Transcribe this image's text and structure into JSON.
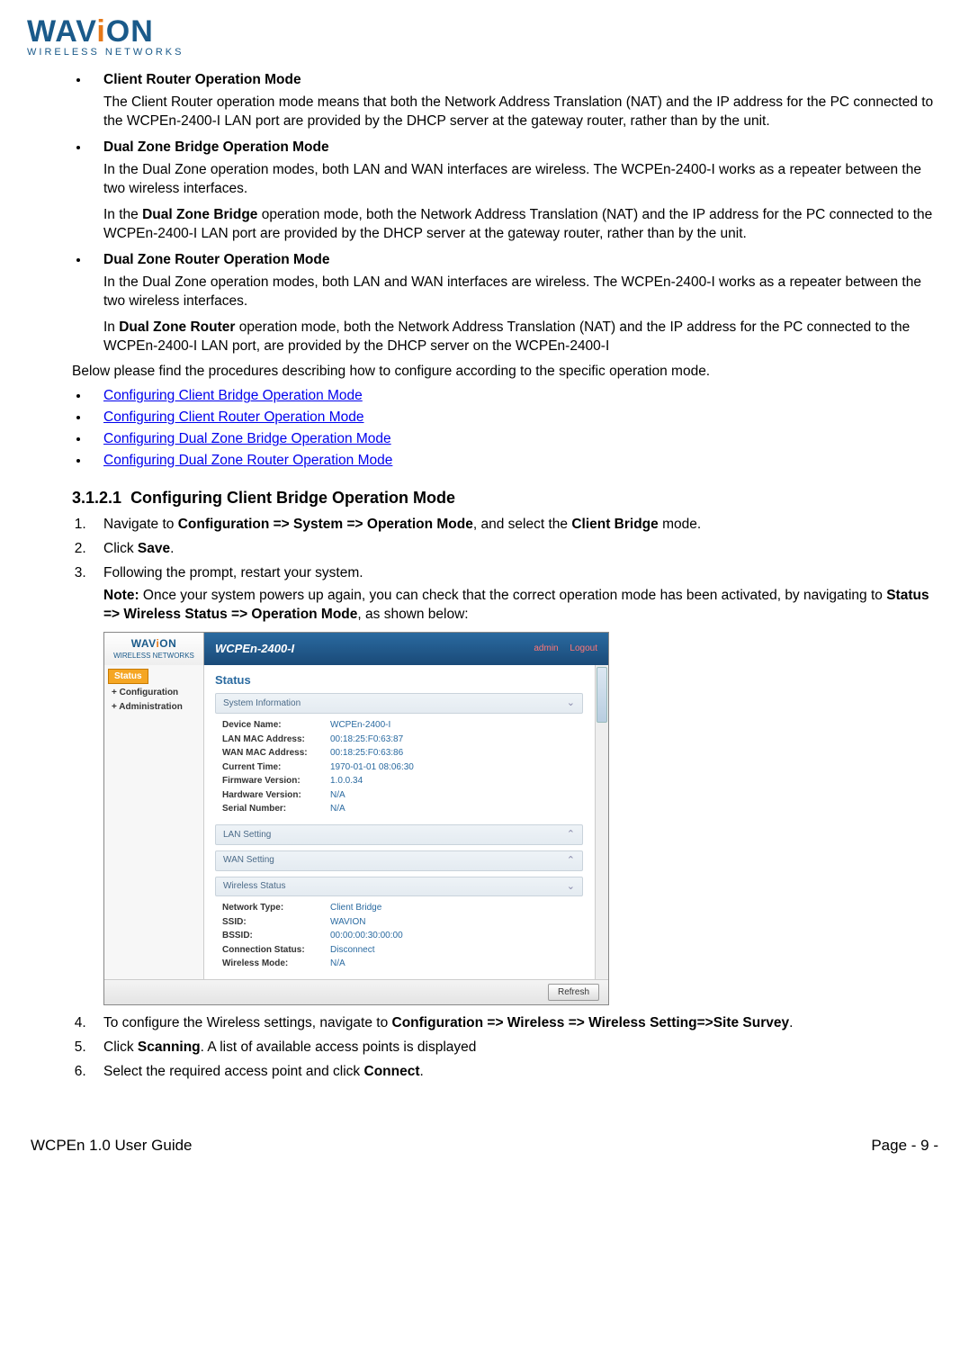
{
  "logo": {
    "main_pre": "WAV",
    "main_mid": "i",
    "main_post": "ON",
    "sub": "WIRELESS NETWORKS"
  },
  "sections": {
    "crom_title": "Client Router Operation Mode",
    "crom_body": "The Client Router operation mode means that both the Network Address Translation (NAT) and the IP address for the PC connected to the WCPEn-2400-I LAN port are provided by the DHCP server at the gateway router, rather than by the unit.",
    "dzbm_title": "Dual Zone Bridge Operation Mode",
    "dzbm_p1": "In the Dual Zone operation modes, both LAN and WAN interfaces are wireless. The WCPEn-2400-I works as a repeater between the two wireless interfaces.",
    "dzbm_p2_pre": "In the ",
    "dzbm_p2_bold": "Dual Zone Bridge",
    "dzbm_p2_post": " operation mode, both the Network Address Translation (NAT) and the IP address for the PC connected to the WCPEn-2400-I LAN port are provided by the DHCP server at the gateway router, rather than by the unit.",
    "dzrm_title": "Dual Zone Router Operation Mode",
    "dzrm_p1": "In the Dual Zone operation modes, both LAN and WAN interfaces are wireless. The WCPEn-2400-I works as a repeater between the two wireless interfaces.",
    "dzrm_p2_pre": "In ",
    "dzrm_p2_bold": "Dual Zone Router",
    "dzrm_p2_post": " operation mode, both the Network Address Translation (NAT) and the IP address for the PC connected to the WCPEn-2400-I LAN port, are provided by the DHCP server on the WCPEn-2400-I",
    "below": "Below please find the procedures describing how to configure according to the specific operation mode."
  },
  "links": {
    "l1": "Configuring Client Bridge Operation Mode",
    "l2": "Configuring Client Router Operation Mode",
    "l3": "Configuring Dual Zone Bridge Operation Mode",
    "l4": "Configuring Dual Zone Router Operation Mode"
  },
  "heading": {
    "num": "3.1.2.1",
    "text": "Configuring Client Bridge Operation Mode"
  },
  "steps": {
    "s1_pre": "Navigate to ",
    "s1_bold": "Configuration => System => Operation Mode",
    "s1_mid": ", and select the ",
    "s1_bold2": "Client Bridge",
    "s1_post": " mode.",
    "s2_pre": "Click ",
    "s2_bold": "Save",
    "s2_post": ".",
    "s3": "Following the prompt, restart your system.",
    "note_label": "Note:",
    "note_body_pre": " Once your system powers up again, you can check that the correct operation mode has been activated, by navigating to ",
    "note_body_bold": "Status => Wireless Status => Operation Mode",
    "note_body_post": ", as shown below:",
    "s4_pre": "To configure the Wireless settings, navigate to ",
    "s4_bold": "Configuration => Wireless => Wireless Setting=>Site Survey",
    "s4_post": ".",
    "s5_pre": "Click ",
    "s5_bold": "Scanning",
    "s5_post": ". A list of available access points is displayed",
    "s6_pre": "Select the required access point and click ",
    "s6_bold": "Connect",
    "s6_post": "."
  },
  "ui": {
    "title": "WCPEn-2400-I",
    "admin": "admin",
    "logout": "Logout",
    "side_status": "Status",
    "side_config": "+ Configuration",
    "side_admin": "+ Administration",
    "h_status": "Status",
    "panel_sysinfo": "System Information",
    "panel_lan": "LAN Setting",
    "panel_wan": "WAN Setting",
    "panel_wireless": "Wireless Status",
    "kv1_k": "Device Name:",
    "kv1_v": "WCPEn-2400-I",
    "kv2_k": "LAN MAC Address:",
    "kv2_v": "00:18:25:F0:63:87",
    "kv3_k": "WAN MAC Address:",
    "kv3_v": "00:18:25:F0:63:86",
    "kv4_k": "Current Time:",
    "kv4_v": "1970-01-01 08:06:30",
    "kv5_k": "Firmware Version:",
    "kv5_v": "1.0.0.34",
    "kv6_k": "Hardware Version:",
    "kv6_v": "N/A",
    "kv7_k": "Serial Number:",
    "kv7_v": "N/A",
    "wv1_k": "Network Type:",
    "wv1_v": "Client Bridge",
    "wv2_k": "SSID:",
    "wv2_v": "WAVION",
    "wv3_k": "BSSID:",
    "wv3_v": "00:00:00:30:00:00",
    "wv4_k": "Connection Status:",
    "wv4_v": "Disconnect",
    "wv5_k": "Wireless Mode:",
    "wv5_v": "N/A",
    "refresh": "Refresh"
  },
  "footer": {
    "left": "WCPEn 1.0 User Guide",
    "right": "Page - 9 -"
  }
}
